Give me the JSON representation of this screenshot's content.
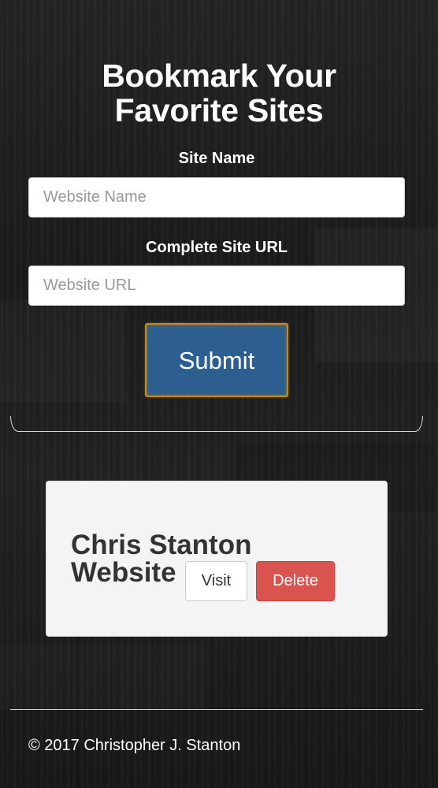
{
  "header": {
    "title_line1": "Bookmark Your",
    "title_line2": "Favorite Sites"
  },
  "form": {
    "site_name_label": "Site Name",
    "site_name_placeholder": "Website Name",
    "site_name_value": "",
    "site_url_label": "Complete Site URL",
    "site_url_placeholder": "Website URL",
    "site_url_value": "",
    "submit_label": "Submit"
  },
  "bookmarks": [
    {
      "name_line1": "Chris Stanton",
      "name_line2": "Website",
      "visit_label": "Visit",
      "delete_label": "Delete"
    }
  ],
  "footer": {
    "copyright": "© 2017 Christopher J. Stanton"
  },
  "colors": {
    "background": "#1e1e1e",
    "submit_bg": "#2c5f8f",
    "submit_border": "#c98a1a",
    "delete_bg": "#d9534f",
    "card_bg": "#f4f4f4"
  }
}
